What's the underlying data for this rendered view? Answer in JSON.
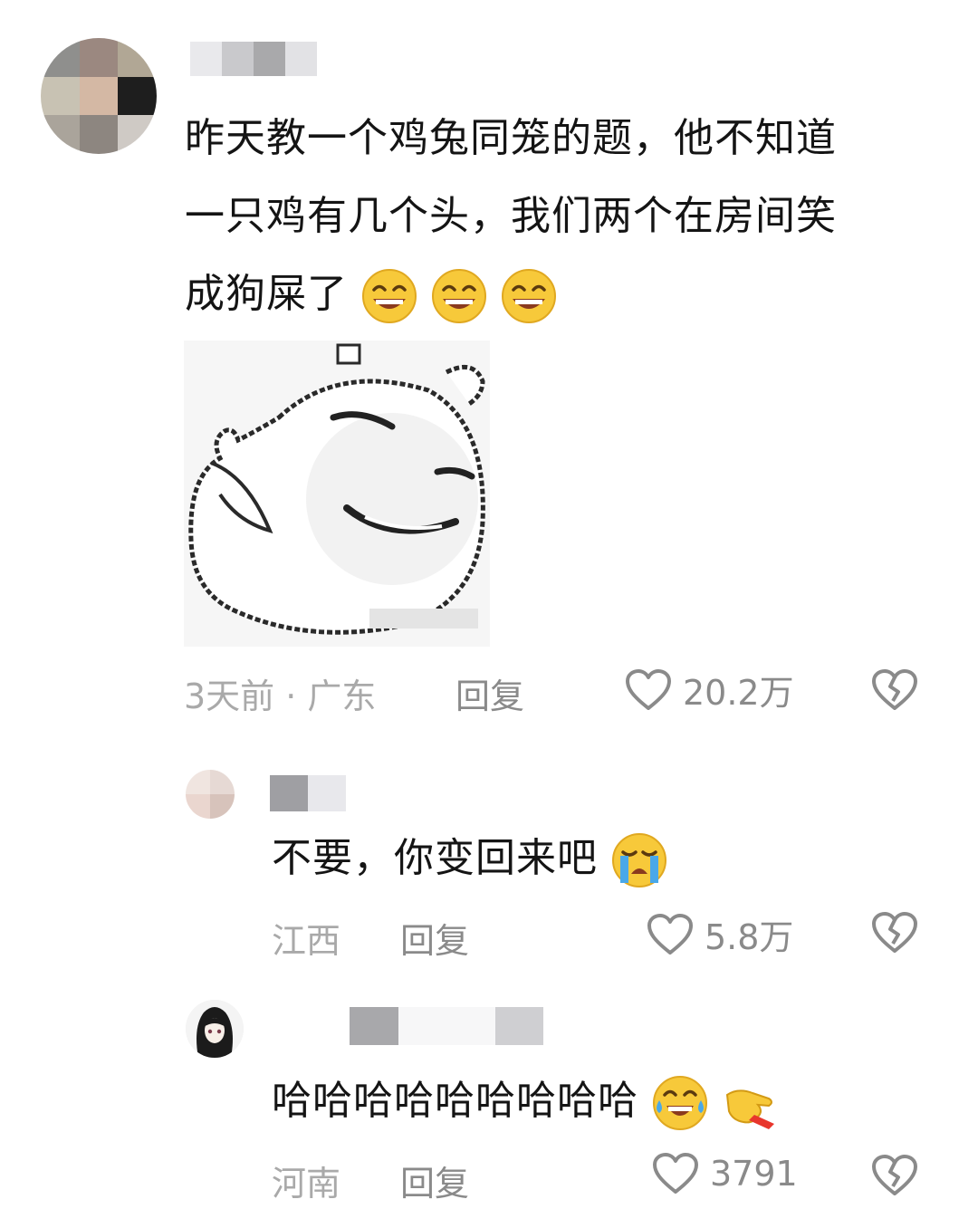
{
  "colors": {
    "text": "#141414",
    "meta": "#a9a9a9",
    "action": "#8a8a8a",
    "icon": "#8a8a8a"
  },
  "comments": [
    {
      "text_lines": [
        "昨天教一个鸡兔同笼的题，他不知道",
        "一只鸡有几个头，我们两个在房间笑",
        "成狗屎了"
      ],
      "emoji": [
        "grinning-face",
        "grinning-face",
        "grinning-face"
      ],
      "image": "cartoon-sticker",
      "meta": "3天前 · 广东",
      "reply_label": "回复",
      "likes": "20.2万"
    }
  ],
  "replies": [
    {
      "text": "不要，你变回来吧",
      "emoji": [
        "loudly-crying-face"
      ],
      "meta": "江西",
      "reply_label": "回复",
      "likes": "5.8万"
    },
    {
      "text": "哈哈哈哈哈哈哈哈哈",
      "emoji": [
        "face-with-tears-of-joy",
        "pointing-hand"
      ],
      "meta": "河南",
      "reply_label": "回复",
      "likes": "3791"
    }
  ]
}
